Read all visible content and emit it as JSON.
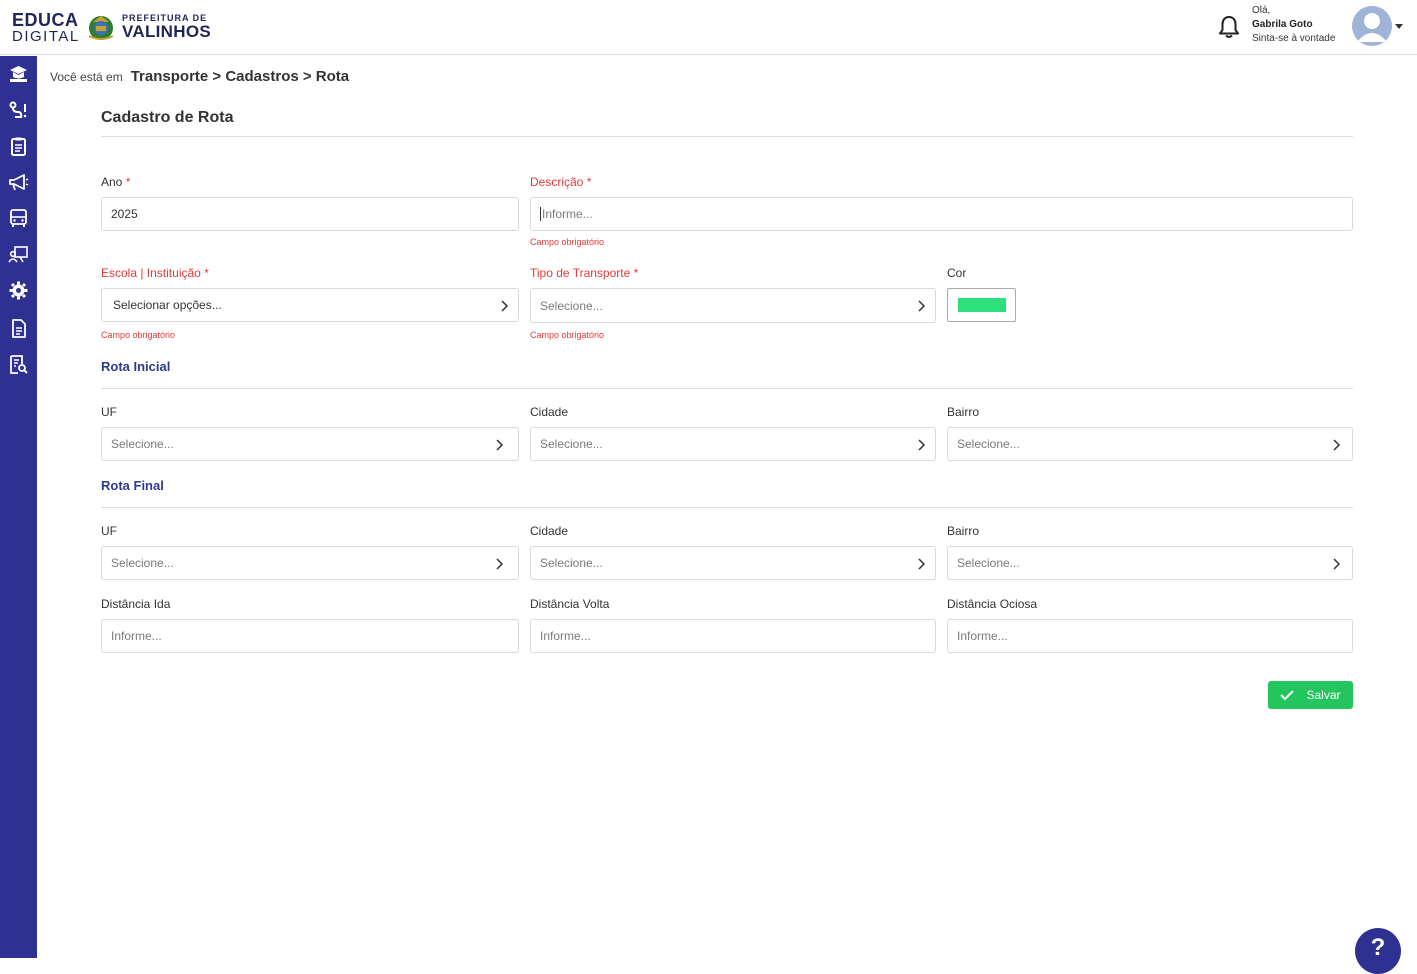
{
  "header": {
    "logo_line1": "EDUCA",
    "logo_line2": "DIGITAL",
    "pref_line1": "PREFEITURA DE",
    "pref_line2": "VALINHOS",
    "greeting": "Olá,",
    "user_name": "Gabrila Goto",
    "user_sub": "Sinta-se à vontade"
  },
  "sidebar": {
    "icons": [
      "graduation-icon",
      "route-icon",
      "clipboard-icon",
      "megaphone-icon",
      "bus-icon",
      "teacher-icon",
      "gear-icon",
      "document-icon",
      "report-search-icon"
    ]
  },
  "breadcrumb": {
    "prefix": "Você está em",
    "path": "Transporte > Cadastros > Rota"
  },
  "page": {
    "title": "Cadastro de Rota"
  },
  "form": {
    "ano": {
      "label": "Ano",
      "value": "2025"
    },
    "descricao": {
      "label": "Descrição",
      "placeholder": "Informe...",
      "error": "Campo obrigatório"
    },
    "escola": {
      "label": "Escola | Instituição",
      "placeholder": "Selecionar opções...",
      "error": "Campo obrigatório"
    },
    "tipo_transporte": {
      "label": "Tipo de Transporte",
      "placeholder": "Selecione...",
      "error": "Campo obrigatório"
    },
    "cor": {
      "label": "Cor",
      "value": "#2ee07a"
    },
    "required_mark": "*"
  },
  "rota_inicial": {
    "title": "Rota Inicial",
    "uf": {
      "label": "UF",
      "placeholder": "Selecione..."
    },
    "cidade": {
      "label": "Cidade",
      "placeholder": "Selecione..."
    },
    "bairro": {
      "label": "Bairro",
      "placeholder": "Selecione..."
    }
  },
  "rota_final": {
    "title": "Rota Final",
    "uf": {
      "label": "UF",
      "placeholder": "Selecione..."
    },
    "cidade": {
      "label": "Cidade",
      "placeholder": "Selecione..."
    },
    "bairro": {
      "label": "Bairro",
      "placeholder": "Selecione..."
    }
  },
  "distancias": {
    "ida": {
      "label": "Distância Ida",
      "placeholder": "Informe..."
    },
    "volta": {
      "label": "Distância Volta",
      "placeholder": "Informe..."
    },
    "ociosa": {
      "label": "Distância Ociosa",
      "placeholder": "Informe..."
    }
  },
  "actions": {
    "save_label": "Salvar",
    "help_label": "?"
  },
  "colors": {
    "primary": "#2e3192",
    "error": "#e53935",
    "success": "#22c55e"
  }
}
